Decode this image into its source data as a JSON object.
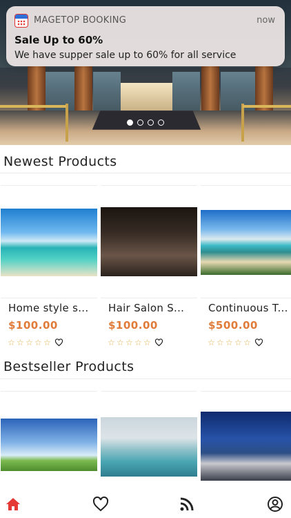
{
  "notification": {
    "app_name": "MAGETOP BOOKING",
    "time": "now",
    "title": "Sale Up to 60%",
    "body": "We have supper sale up to 60% for all service"
  },
  "banner": {
    "slide_count": 4,
    "active_slide": 1
  },
  "newest": {
    "title": "Newest Products",
    "products": [
      {
        "name": "Home style s...",
        "price": "$100.00",
        "rating": 0
      },
      {
        "name": "Hair Salon S...",
        "price": "$100.00",
        "rating": 0
      },
      {
        "name": "Continuous T...",
        "price": "$500.00",
        "rating": 0
      }
    ]
  },
  "bestseller": {
    "title": "Bestseller Products"
  },
  "tabbar": {
    "items": [
      "home-icon",
      "heart-icon",
      "rss-icon",
      "account-icon"
    ],
    "active_color": "#e53935",
    "inactive_color": "#222222"
  },
  "colors": {
    "price": "#e07b39",
    "star": "#e3b04b"
  }
}
